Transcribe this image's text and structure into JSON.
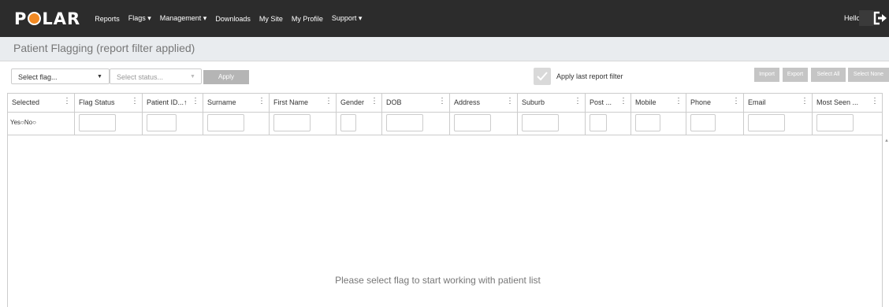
{
  "app": {
    "logo_text_left": "P",
    "logo_text_right": "LAR"
  },
  "nav": [
    "Reports",
    "Flags ▾",
    "Management ▾",
    "Downloads",
    "My Site",
    "My Profile",
    "Support ▾"
  ],
  "user": {
    "greeting": "Hello"
  },
  "page": {
    "title": "Patient Flagging (report filter applied)"
  },
  "toolbar": {
    "flag_select": "Select flag...",
    "status_select": "Select status...",
    "apply_label": "Apply",
    "apply_last_filter_label": "Apply last report filter",
    "apply_last_filter_checked": true,
    "buttons": [
      "Import",
      "Export",
      "Select All",
      "Select None"
    ]
  },
  "grid": {
    "columns": [
      "Selected",
      "Flag Status",
      "Patient ID...↑",
      "Surname",
      "First Name",
      "Gender",
      "DOB",
      "Address",
      "Suburb",
      "Post ...",
      "Mobile",
      "Phone",
      "Email",
      "Most Seen ..."
    ],
    "selected_filter_text": "Yes○No○",
    "empty_message": "Please select flag to start working with patient list"
  },
  "colors": {
    "topbar": "#2c2c2c",
    "accent": "#f28a24",
    "titlebar": "#e9ecef"
  }
}
